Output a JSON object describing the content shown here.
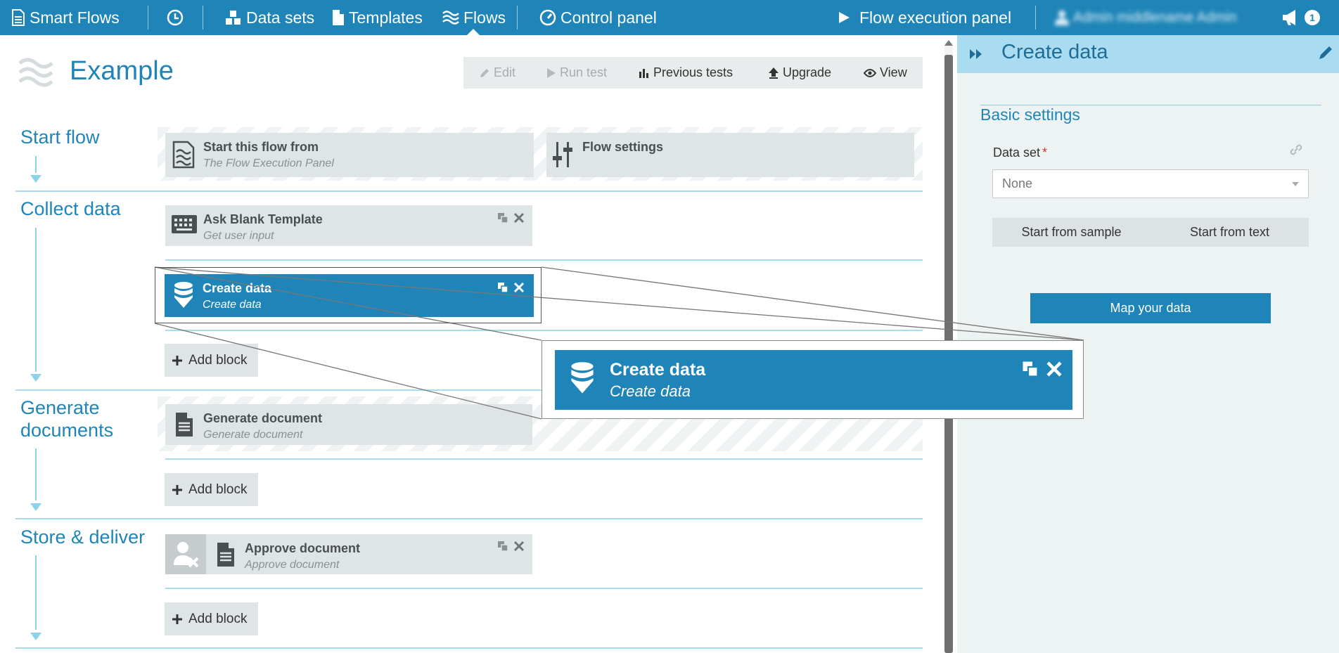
{
  "nav": {
    "brand": "Smart Flows",
    "datasets": "Data sets",
    "templates": "Templates",
    "flows": "Flows",
    "control_panel": "Control panel",
    "flow_execution_panel": "Flow execution panel",
    "user": "Admin middlename Admin",
    "notification_count": "1",
    "active_item": "Flows"
  },
  "flow": {
    "title": "Example",
    "toolbar": {
      "edit": "Edit",
      "run_test": "Run test",
      "previous_tests": "Previous tests",
      "upgrade": "Upgrade",
      "view": "View"
    }
  },
  "sections": {
    "start": {
      "label": "Start flow",
      "blocks": [
        {
          "title": "Start this flow from",
          "subtitle": "The Flow Execution Panel",
          "icon": "flow-start-icon"
        },
        {
          "title": "Flow settings",
          "subtitle": "",
          "icon": "sliders-icon"
        }
      ]
    },
    "collect": {
      "label": "Collect data",
      "blocks": [
        {
          "title": "Ask Blank Template",
          "subtitle": "Get user input",
          "icon": "keyboard-icon"
        },
        {
          "title": "Create data",
          "subtitle": "Create data",
          "icon": "database-icon",
          "selected": true
        }
      ],
      "add_label": "Add block"
    },
    "generate": {
      "label": "Generate documents",
      "blocks": [
        {
          "title": "Generate document",
          "subtitle": "Generate document",
          "icon": "document-icon"
        }
      ],
      "add_label": "Add block"
    },
    "store": {
      "label": "Store & deliver",
      "blocks": [
        {
          "title": "Approve document",
          "subtitle": "Approve document",
          "icon": "document-icon"
        }
      ],
      "add_label": "Add block"
    }
  },
  "zoom": {
    "title": "Create data",
    "subtitle": "Create data"
  },
  "panel": {
    "title": "Create data",
    "section": "Basic settings",
    "dataset_label": "Data set",
    "required_mark": "*",
    "dataset_value": "None",
    "tab_sample": "Start from sample",
    "tab_text": "Start from text",
    "map_button": "Map your data"
  },
  "colors": {
    "brand": "#1f85b8",
    "panel_header": "#a9dcf0",
    "block_bg": "#dfe5e6",
    "section_line": "#a9dcee",
    "required": "#d9372c"
  }
}
